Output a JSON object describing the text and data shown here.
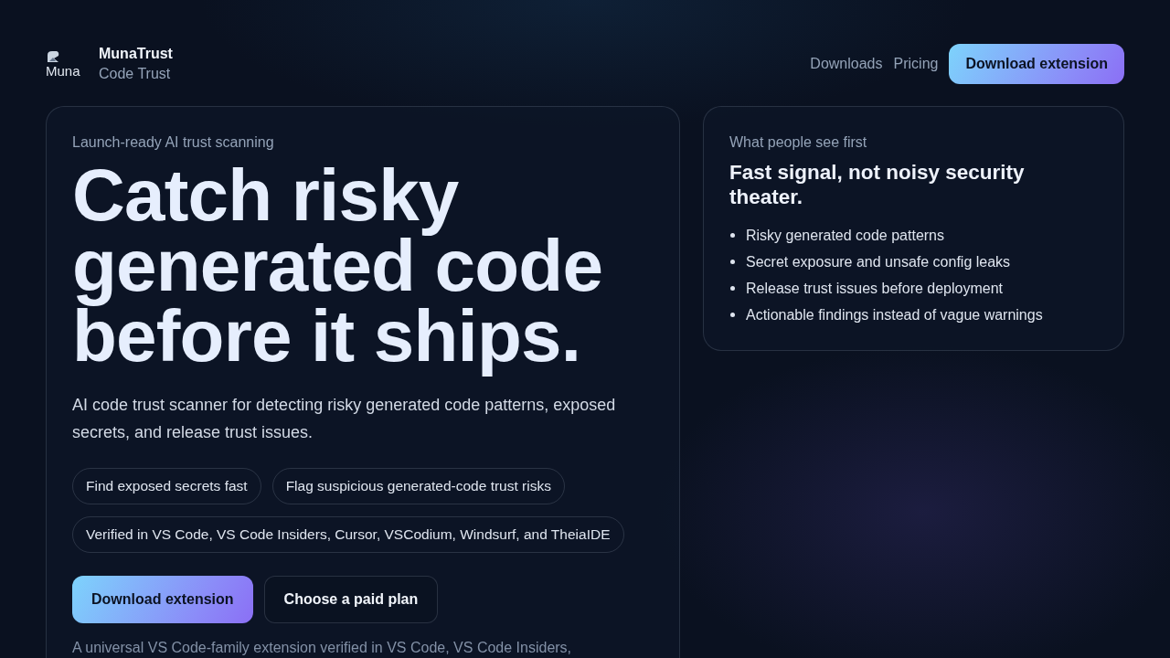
{
  "header": {
    "logo": {
      "text": "Muna"
    },
    "brand": {
      "name": "MunaTrust",
      "tagline": "Code Trust"
    },
    "nav": [
      {
        "label": "Downloads"
      },
      {
        "label": "Pricing"
      }
    ],
    "cta": {
      "label": "Download extension"
    }
  },
  "hero": {
    "eyebrow": "Launch-ready AI trust scanning",
    "headline": "Catch risky generated code before it ships.",
    "description": "AI code trust scanner for detecting risky generated code patterns, exposed secrets, and release trust issues.",
    "chips": [
      "Find exposed secrets fast",
      "Flag suspicious generated-code trust risks",
      "Verified in VS Code, VS Code Insiders, Cursor, VSCodium, Windsurf, and TheiaIDE"
    ],
    "buttons": [
      {
        "label": "Download extension",
        "kind": "primary"
      },
      {
        "label": "Choose a paid plan",
        "kind": "secondary"
      }
    ],
    "note": "A universal VS Code-family extension verified in VS Code, VS Code Insiders,"
  },
  "highlights": {
    "eyebrow": "What people see first",
    "title": "Fast signal, not noisy security theater.",
    "items": [
      "Risky generated code patterns",
      "Secret exposure and unsafe config leaks",
      "Release trust issues before deployment",
      "Actionable findings instead of vague warnings"
    ]
  }
}
